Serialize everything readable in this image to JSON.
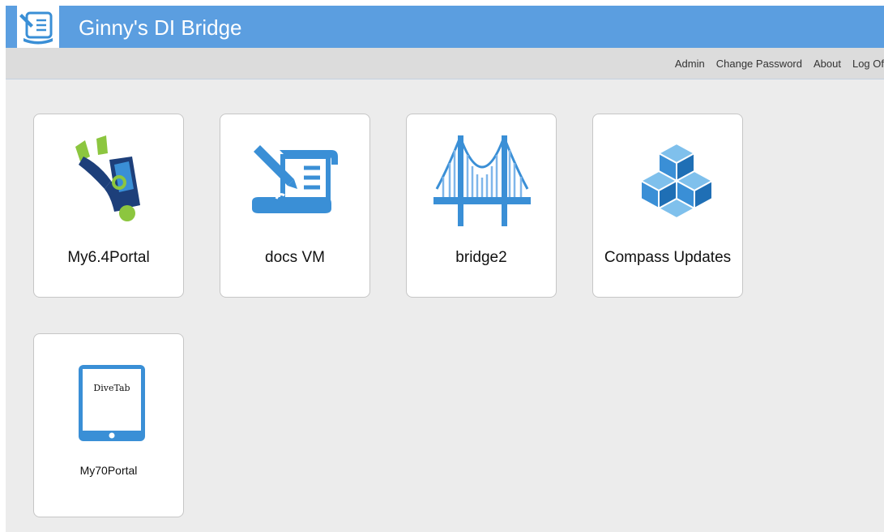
{
  "app": {
    "title": "Ginny's DI Bridge",
    "logo_icon": "scroll-pen-icon"
  },
  "menu": {
    "items": [
      {
        "label": "Admin"
      },
      {
        "label": "Change Password"
      },
      {
        "label": "About"
      },
      {
        "label": "Log Of"
      }
    ]
  },
  "tiles": [
    {
      "label": "My6.4Portal",
      "icon": "diver-icon"
    },
    {
      "label": "docs VM",
      "icon": "scroll-pen-icon"
    },
    {
      "label": "bridge2",
      "icon": "bridge-icon"
    },
    {
      "label": "Compass Updates",
      "icon": "cubes-icon"
    },
    {
      "label": "My70Portal",
      "icon": "tablet-icon",
      "icon_text": "DiveTab"
    }
  ],
  "colors": {
    "header": "#5b9ee0",
    "menubar": "#dcdcdc",
    "background": "#ececec",
    "icon_blue": "#3a8fd6",
    "icon_green": "#8cc63f"
  }
}
